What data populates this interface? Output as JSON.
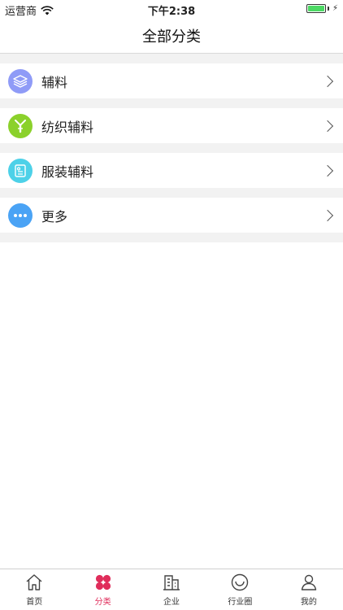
{
  "status_bar": {
    "carrier": "运营商",
    "time": "下午2:38",
    "battery_level": 1.0
  },
  "nav": {
    "title": "全部分类"
  },
  "categories": [
    {
      "label": "辅料",
      "icon": "layers-icon",
      "color": "#8f9bf7"
    },
    {
      "label": "纺织辅料",
      "icon": "yarn-spool-icon",
      "color": "#8bd12b"
    },
    {
      "label": "服装辅料",
      "icon": "clothing-tag-icon",
      "color": "#4dd1e8"
    },
    {
      "label": "更多",
      "icon": "more-dots-icon",
      "color": "#4aa3f5"
    }
  ],
  "tabs": [
    {
      "label": "首页",
      "icon": "home-icon",
      "active": false
    },
    {
      "label": "分类",
      "icon": "category-icon",
      "active": true
    },
    {
      "label": "企业",
      "icon": "building-icon",
      "active": false
    },
    {
      "label": "行业圈",
      "icon": "smile-circle-icon",
      "active": false
    },
    {
      "label": "我的",
      "icon": "user-icon",
      "active": false
    }
  ],
  "colors": {
    "accent": "#e02d5b",
    "separator": "#f2f2f2"
  }
}
